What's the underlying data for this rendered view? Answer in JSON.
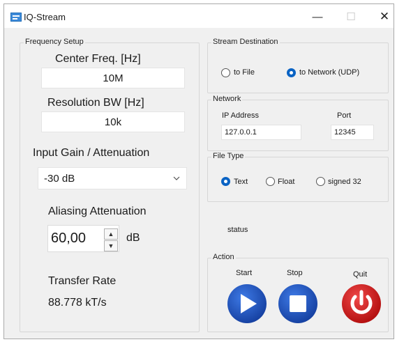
{
  "window": {
    "title": "IQ-Stream",
    "minimize_glyph": "—",
    "maximize_glyph": "☐",
    "close_glyph": "✕"
  },
  "frequency_setup": {
    "group_label": "Frequency Setup",
    "center_freq_label": "Center Freq. [Hz]",
    "center_freq_value": "10M",
    "resolution_bw_label": "Resolution BW [Hz]",
    "resolution_bw_value": "10k",
    "input_gain_label": "Input Gain / Attenuation",
    "input_gain_selected": "-30 dB",
    "aliasing_label": "Aliasing Attenuation",
    "aliasing_value": "60,00",
    "aliasing_unit": "dB",
    "transfer_rate_label": "Transfer Rate",
    "transfer_rate_value": "88.778 kT/s"
  },
  "stream_destination": {
    "group_label": "Stream Destination",
    "options": [
      {
        "label": "to File",
        "checked": false
      },
      {
        "label": "to Network (UDP)",
        "checked": true
      }
    ]
  },
  "network": {
    "group_label": "Network",
    "ip_label": "IP Address",
    "ip_value": "127.0.0.1",
    "port_label": "Port",
    "port_value": "12345"
  },
  "file_type": {
    "group_label": "File Type",
    "options": [
      {
        "label": "Text",
        "checked": true
      },
      {
        "label": "Float",
        "checked": false
      },
      {
        "label": "signed 32",
        "checked": false
      }
    ]
  },
  "status": {
    "text": "status"
  },
  "action": {
    "group_label": "Action",
    "start_label": "Start",
    "stop_label": "Stop",
    "quit_label": "Quit",
    "start_icon": "play-icon",
    "stop_icon": "stop-icon",
    "quit_icon": "power-icon"
  },
  "colors": {
    "accent": "#0a63c4",
    "play_button": "#1d4fb8",
    "stop_button": "#1d4fb8",
    "quit_button": "#cc1414"
  }
}
